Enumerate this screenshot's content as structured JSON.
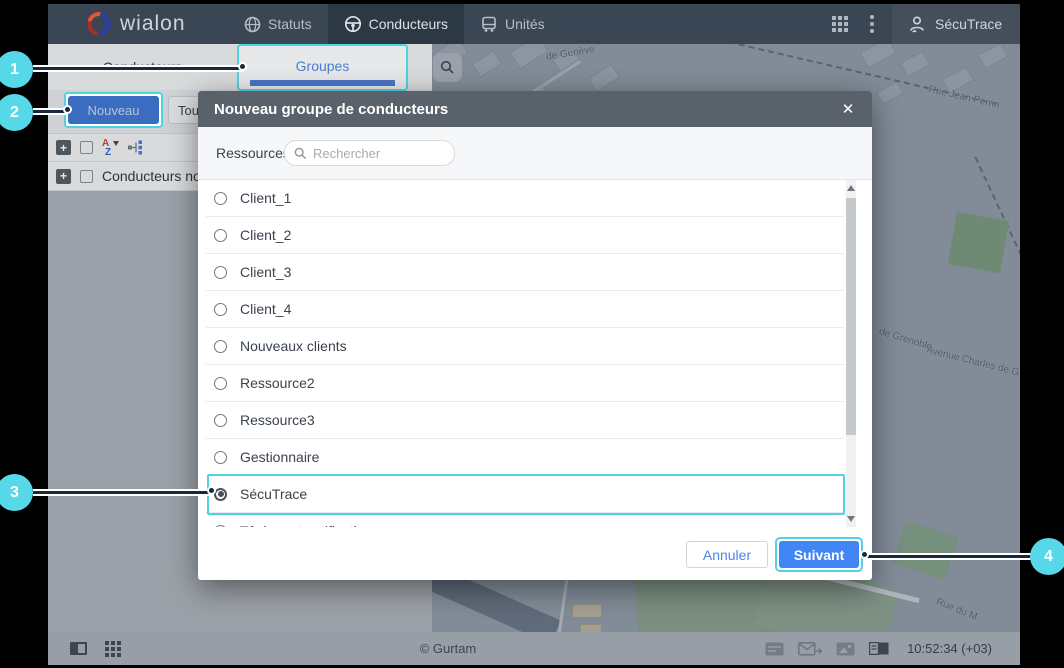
{
  "navbar": {
    "logo_text": "wialon",
    "items": [
      {
        "label": "Statuts",
        "icon": "globe-icon"
      },
      {
        "label": "Conducteurs",
        "icon": "steering-wheel-icon"
      },
      {
        "label": "Unités",
        "icon": "bus-icon"
      }
    ],
    "user_label": "SécuTrace"
  },
  "panel": {
    "tabs": [
      {
        "label": "Conducteurs"
      },
      {
        "label": "Groupes"
      }
    ],
    "new_button_label": "Nouveau",
    "filter_button_label": "Tout",
    "group_row_label": "Conducteurs nor"
  },
  "modal": {
    "title": "Nouveau groupe de conducteurs",
    "close_label": "✕",
    "resources_label": "Ressources",
    "search_placeholder": "Rechercher",
    "options": [
      {
        "label": "Client_1",
        "selected": false
      },
      {
        "label": "Client_2",
        "selected": false
      },
      {
        "label": "Client_3",
        "selected": false
      },
      {
        "label": "Client_4",
        "selected": false
      },
      {
        "label": "Nouveaux clients",
        "selected": false
      },
      {
        "label": "Ressource2",
        "selected": false
      },
      {
        "label": "Ressource3",
        "selected": false
      },
      {
        "label": "Gestionnaire",
        "selected": false
      },
      {
        "label": "SécuTrace",
        "selected": true
      },
      {
        "label": "Tâches et notifications",
        "selected": false
      }
    ],
    "cancel_label": "Annuler",
    "next_label": "Suivant"
  },
  "map": {
    "labels": [
      "de Genève",
      "Rue Jean Perrin",
      "de Grenoble",
      "Avenue Charles de G",
      "Rue du M"
    ],
    "zoom_in_label": "+",
    "zoom_out_label": "−"
  },
  "statusbar": {
    "copyright": "© Gurtam",
    "clock": "10:52:34 (+03)"
  },
  "callouts": [
    {
      "number": "1"
    },
    {
      "number": "2"
    },
    {
      "number": "3"
    },
    {
      "number": "4"
    }
  ],
  "colors": {
    "accent_blue": "#4285f4",
    "highlight_cyan": "#4ed2e4",
    "callout_cyan": "#57d8e8",
    "navbar_bg": "#3a4653",
    "modal_header_bg": "#59626b"
  }
}
